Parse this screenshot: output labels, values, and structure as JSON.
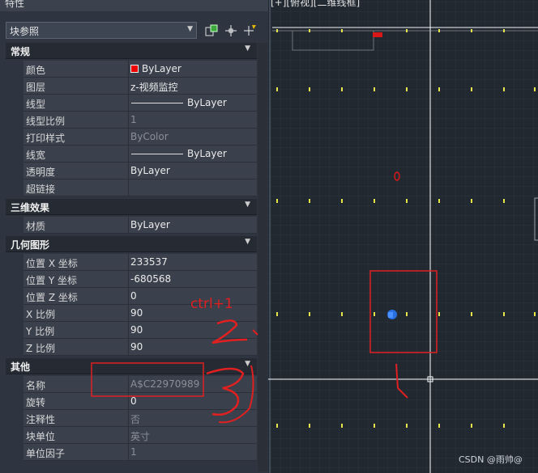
{
  "panel": {
    "title": "特性",
    "type_select": "块参照",
    "sections": {
      "general": "常规",
      "effects3d": "三维效果",
      "geometry": "几何图形",
      "misc": "其他"
    },
    "general_rows": [
      {
        "label": "颜色",
        "value": "ByLayer"
      },
      {
        "label": "图层",
        "value": "z-视频监控"
      },
      {
        "label": "线型",
        "value": "ByLayer"
      },
      {
        "label": "线型比例",
        "value": "1"
      },
      {
        "label": "打印样式",
        "value": "ByColor"
      },
      {
        "label": "线宽",
        "value": "ByLayer"
      },
      {
        "label": "透明度",
        "value": "ByLayer"
      },
      {
        "label": "超链接",
        "value": ""
      }
    ],
    "effects_rows": [
      {
        "label": "材质",
        "value": "ByLayer"
      }
    ],
    "geometry_rows": [
      {
        "label": "位置 X 坐标",
        "value": "233537"
      },
      {
        "label": "位置 Y 坐标",
        "value": "-680568"
      },
      {
        "label": "位置 Z 坐标",
        "value": "0"
      },
      {
        "label": "X 比例",
        "value": "90"
      },
      {
        "label": "Y 比例",
        "value": "90"
      },
      {
        "label": "Z 比例",
        "value": "90"
      }
    ],
    "misc_rows": [
      {
        "label": "名称",
        "value": "A$C22970989"
      },
      {
        "label": "旋转",
        "value": "0"
      },
      {
        "label": "注释性",
        "value": "否"
      },
      {
        "label": "块单位",
        "value": "英寸"
      },
      {
        "label": "单位因子",
        "value": "1"
      }
    ],
    "color_swatch": "#e00000"
  },
  "canvas": {
    "view_label": "[+][俯视][二维线框]",
    "watermark": "CSDN @雨帅@"
  },
  "annotations": {
    "shortcut": "ctrl+1",
    "step1": "1.",
    "step2": "2.",
    "step3": "3."
  },
  "colors": {
    "annotation_red": "#e02020",
    "marker_yellow": "#e6e64a",
    "crosshair": "#ffffff",
    "selected_block": "#2a6fe0"
  }
}
